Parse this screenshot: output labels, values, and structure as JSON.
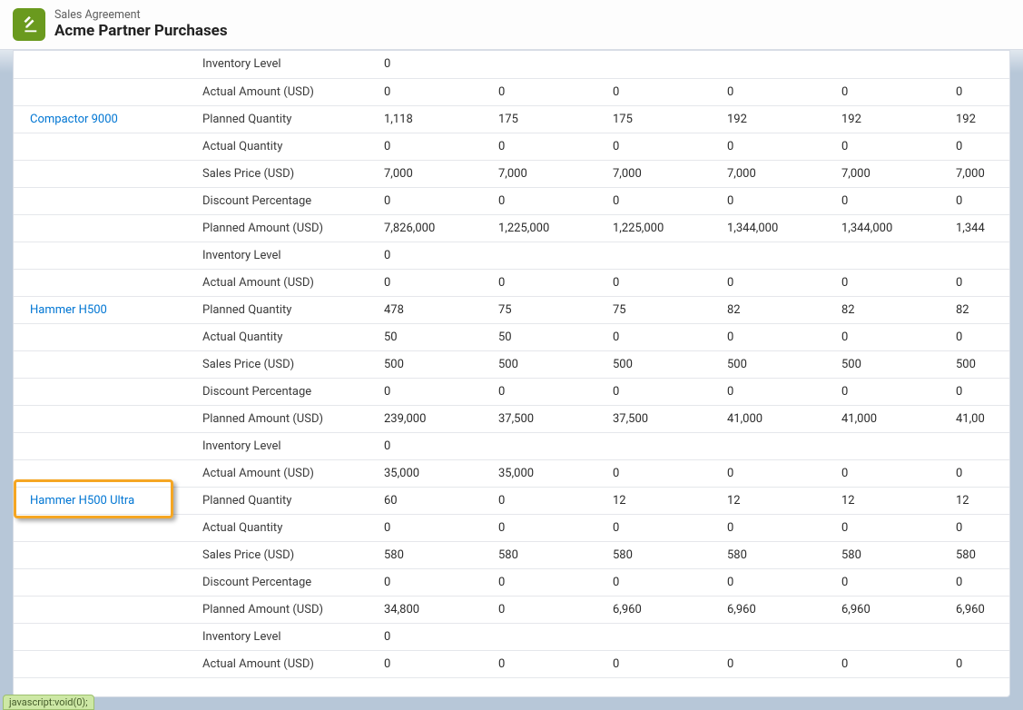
{
  "header": {
    "object_label": "Sales Agreement",
    "record_name": "Acme Partner Purchases"
  },
  "metrics": [
    "Inventory Level",
    "Actual Amount (USD)",
    "Planned Quantity",
    "Actual Quantity",
    "Sales Price (USD)",
    "Discount Percentage",
    "Planned Amount (USD)",
    "Inventory Level",
    "Actual Amount (USD)"
  ],
  "products": [
    {
      "name": "",
      "is_link": false,
      "highlight": false,
      "rows": [
        {
          "metric_index": 0,
          "values": [
            "0",
            "",
            "",
            "",
            "",
            ""
          ]
        },
        {
          "metric_index": 1,
          "values": [
            "0",
            "0",
            "0",
            "0",
            "0",
            "0"
          ]
        }
      ]
    },
    {
      "name": "Compactor 9000",
      "is_link": true,
      "highlight": false,
      "rows": [
        {
          "metric_index": 2,
          "values": [
            "1,118",
            "175",
            "175",
            "192",
            "192",
            "192"
          ]
        },
        {
          "metric_index": 3,
          "values": [
            "0",
            "0",
            "0",
            "0",
            "0",
            "0"
          ]
        },
        {
          "metric_index": 4,
          "values": [
            "7,000",
            "7,000",
            "7,000",
            "7,000",
            "7,000",
            "7,000"
          ]
        },
        {
          "metric_index": 5,
          "values": [
            "0",
            "0",
            "0",
            "0",
            "0",
            "0"
          ]
        },
        {
          "metric_index": 6,
          "values": [
            "7,826,000",
            "1,225,000",
            "1,225,000",
            "1,344,000",
            "1,344,000",
            "1,344"
          ]
        },
        {
          "metric_index": 7,
          "values": [
            "0",
            "",
            "",
            "",
            "",
            ""
          ]
        },
        {
          "metric_index": 8,
          "values": [
            "0",
            "0",
            "0",
            "0",
            "0",
            "0"
          ]
        }
      ]
    },
    {
      "name": "Hammer H500",
      "is_link": true,
      "highlight": false,
      "rows": [
        {
          "metric_index": 2,
          "values": [
            "478",
            "75",
            "75",
            "82",
            "82",
            "82"
          ]
        },
        {
          "metric_index": 3,
          "values": [
            "50",
            "50",
            "0",
            "0",
            "0",
            "0"
          ]
        },
        {
          "metric_index": 4,
          "values": [
            "500",
            "500",
            "500",
            "500",
            "500",
            "500"
          ]
        },
        {
          "metric_index": 5,
          "values": [
            "0",
            "0",
            "0",
            "0",
            "0",
            "0"
          ]
        },
        {
          "metric_index": 6,
          "values": [
            "239,000",
            "37,500",
            "37,500",
            "41,000",
            "41,000",
            "41,00"
          ]
        },
        {
          "metric_index": 7,
          "values": [
            "0",
            "",
            "",
            "",
            "",
            ""
          ]
        },
        {
          "metric_index": 8,
          "values": [
            "35,000",
            "35,000",
            "0",
            "0",
            "0",
            "0"
          ]
        }
      ]
    },
    {
      "name": "Hammer H500 Ultra",
      "is_link": true,
      "highlight": true,
      "rows": [
        {
          "metric_index": 2,
          "values": [
            "60",
            "0",
            "12",
            "12",
            "12",
            "12"
          ]
        },
        {
          "metric_index": 3,
          "values": [
            "0",
            "0",
            "0",
            "0",
            "0",
            "0"
          ]
        },
        {
          "metric_index": 4,
          "values": [
            "580",
            "580",
            "580",
            "580",
            "580",
            "580"
          ]
        },
        {
          "metric_index": 5,
          "values": [
            "0",
            "0",
            "0",
            "0",
            "0",
            "0"
          ]
        },
        {
          "metric_index": 6,
          "values": [
            "34,800",
            "0",
            "6,960",
            "6,960",
            "6,960",
            "6,960"
          ]
        },
        {
          "metric_index": 7,
          "values": [
            "0",
            "",
            "",
            "",
            "",
            ""
          ]
        },
        {
          "metric_index": 8,
          "values": [
            "0",
            "0",
            "0",
            "0",
            "0",
            "0"
          ]
        }
      ]
    }
  ],
  "status_text": "javascript:void(0);"
}
